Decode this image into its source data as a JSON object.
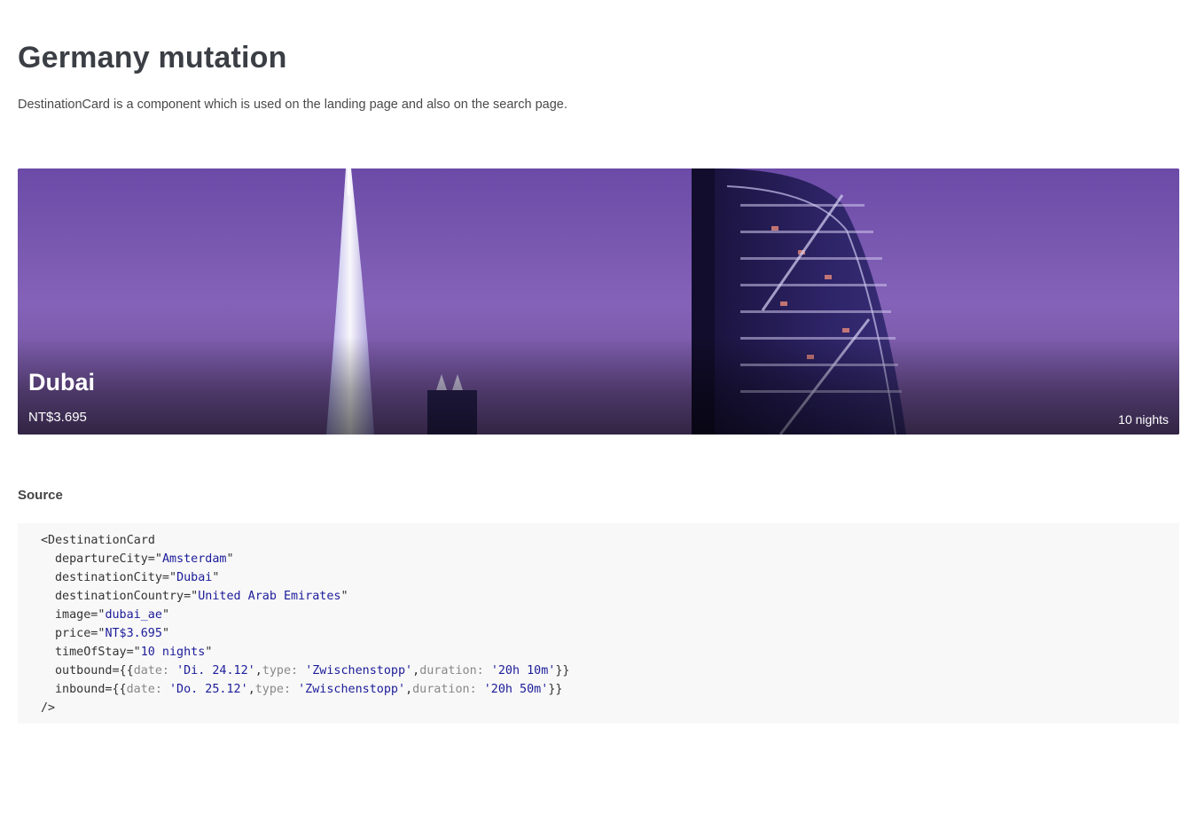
{
  "header": {
    "title": "Germany mutation",
    "description": "DestinationCard is a component which is used on the landing page and also on the search page."
  },
  "card": {
    "city": "Dubai",
    "price": "NT$3.695",
    "stay": "10 nights"
  },
  "source": {
    "heading": "Source",
    "component_open": "<DestinationCard",
    "component_close": "/>",
    "props": [
      {
        "name": "departureCity",
        "value": "Amsterdam"
      },
      {
        "name": "destinationCity",
        "value": "Dubai"
      },
      {
        "name": "destinationCountry",
        "value": "United Arab Emirates"
      },
      {
        "name": "image",
        "value": "dubai_ae"
      },
      {
        "name": "price",
        "value": "NT$3.695"
      },
      {
        "name": "timeOfStay",
        "value": "10 nights"
      }
    ],
    "outbound": {
      "prop": "outbound",
      "date": "'Di. 24.12'",
      "type": "'Zwischenstopp'",
      "duration": "'20h 10m'"
    },
    "inbound": {
      "prop": "inbound",
      "date": "'Do. 25.12'",
      "type": "'Zwischenstopp'",
      "duration": "'20h 50m'"
    }
  },
  "colors": {
    "title": "#3b3f45",
    "code_string": "#1c1c9a",
    "code_key": "#888888",
    "code_background": "#f8f8f8"
  }
}
